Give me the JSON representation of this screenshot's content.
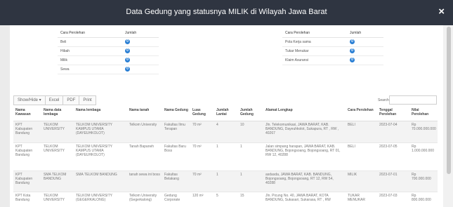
{
  "modal": {
    "title": "Data Gedung yang statusnya MILIK di Wilayah Jawa Barat",
    "close_label": "×"
  },
  "summary": {
    "header_method": "Cara Perolehan",
    "header_count": "Jumlah",
    "left": [
      {
        "method": "Beli",
        "count": "0"
      },
      {
        "method": "Hibah",
        "count": "0"
      },
      {
        "method": "Milik",
        "count": "0"
      },
      {
        "method": "Sewa",
        "count": "0"
      }
    ],
    "right": [
      {
        "method": "Pola Kerja sama",
        "count": "0"
      },
      {
        "method": "Tukar Menukar",
        "count": "0"
      },
      {
        "method": "Klaim Asuransi",
        "count": "0"
      }
    ]
  },
  "toolbar": {
    "show_hide": "Show/Hide ▾",
    "excel": "Excel",
    "pdf": "PDF",
    "print": "Print",
    "search_label": "Search:"
  },
  "table": {
    "columns": [
      "Nama Kawasan",
      "Nama data lembaga",
      "Nama lembaga",
      "Nama tanah",
      "Nama Gedung",
      "Luas Gedung",
      "Jumlah Lantai",
      "Jumlah Gedung",
      "Alamat Lengkap",
      "Cara Perolehan",
      "Tenggal Perolehan",
      "Nilai Perolehan"
    ],
    "rows": [
      [
        "KPT Kabupaten Bandung",
        "TELKOM UNIVERSITY",
        "TELKOM UNIVERSITY KAMPUS UTAMA (DAYEUHKOLOT)",
        "Telkom University",
        "Fakultas Ilmu Terapan",
        "70 m²",
        "4",
        "10",
        "Jln. Telekomunikasi, JAWA BARAT, KAB. BANDUNG, Dayeuhkolot, Sukapura, RT , RW , 40267",
        "BELI",
        "2023-07-04",
        "Rp 70.000.000.000"
      ],
      [
        "KPT Kabupaten Bandung",
        "TELKOM UNIVERSITY",
        "TELKOM UNIVERSITY KAMPUS UTAMA (DAYEUHKOLOT)",
        "Tanah Bapaneh",
        "Fakultas Baru Boss",
        "70 m²",
        "1",
        "1",
        "Jalan simpang harapan, JAWA BARAT, KAB. BANDUNG, Bojongsoang, Bojongsoang, RT 01, RW 12, 40288",
        "BELI",
        "2023-07-05",
        "Rp 1.000.000.000"
      ],
      [
        "KPT Kabupaten Bandung",
        "SMA TELKOM BANDUNG",
        "SMA TELKOM BANDUNG",
        "tanah sewa ini boss",
        "Fakultas Belakang",
        "70 m²",
        "1",
        "1",
        "asdasda, JAWA BARAT, KAB. BANDUNG, Bojongsoang, Bojongsoang, RT 12, RW 54, 40288",
        "MILIK",
        "2023-07-01",
        "Rp 700.000.000"
      ],
      [
        "KPT Kota Bandung",
        "TELKOM UNIVERSITY",
        "TELKOM UNIVERSITY (GEGERKALONG)",
        "Telkom University (Gegerkalong)",
        "Gedung Corporate",
        "120 m²",
        "5",
        "15",
        "Jln. Picung No. 40, JAWA BARAT, KOTA BANDUNG, Sukasari, Sukarasa, RT , RW",
        "TUKAR MENUKAR",
        "2023-07-03",
        "Rp 800.000.000"
      ]
    ]
  }
}
